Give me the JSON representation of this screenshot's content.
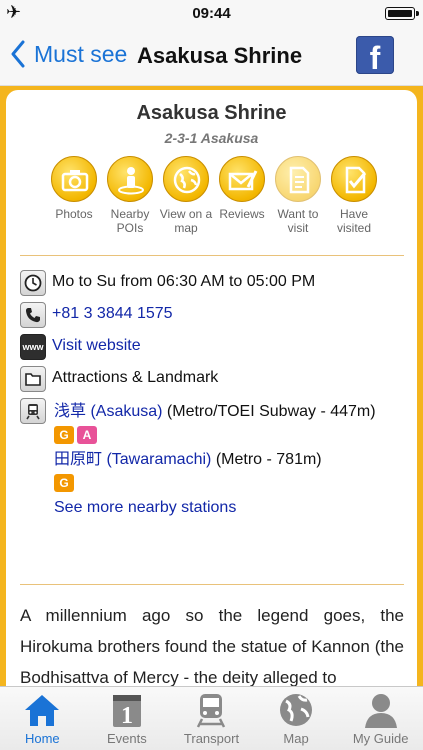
{
  "status": {
    "time": "09:44"
  },
  "nav": {
    "back_label": "Must see",
    "title": "Asakusa Shrine",
    "facebook_label": "f"
  },
  "place": {
    "name": "Asakusa Shrine",
    "address": "2-3-1 Asakusa"
  },
  "actions": [
    {
      "line1": "Photos",
      "line2": ""
    },
    {
      "line1": "Nearby",
      "line2": "POIs"
    },
    {
      "line1": "View on a",
      "line2": "map"
    },
    {
      "line1": "Reviews",
      "line2": ""
    },
    {
      "line1": "Want to",
      "line2": "visit"
    },
    {
      "line1": "Have",
      "line2": "visited"
    }
  ],
  "info": {
    "hours": "Mo to Su from 06:30 AM to 05:00 PM",
    "phone": "+81 3 3844 1575",
    "website": "Visit website",
    "www_icon": "www",
    "category": "Attractions & Landmark"
  },
  "stations": [
    {
      "name": "浅草 (Asakusa)",
      "detail": " (Metro/TOEI Subway - 447m)",
      "badges": [
        "G",
        "A"
      ]
    },
    {
      "name": "田原町 (Tawaramachi)",
      "detail": " (Metro - 781m)",
      "badges": [
        "G"
      ]
    }
  ],
  "badge_colors": {
    "G": "#f39700",
    "A": "#e85298"
  },
  "see_more": "See more nearby stations",
  "description": "A millennium ago so the legend goes, the Hirokuma brothers found the statue of Kannon (the Bodhisattva of Mercy - the deity alleged to",
  "tabs": [
    {
      "label": "Home",
      "icon": "home-icon"
    },
    {
      "label": "Events",
      "icon": "calendar-icon",
      "calendar_day": "1"
    },
    {
      "label": "Transport",
      "icon": "train-icon"
    },
    {
      "label": "Map",
      "icon": "globe-icon"
    },
    {
      "label": "My Guide",
      "icon": "person-icon"
    }
  ],
  "colors": {
    "accent": "#1a73d6",
    "frame": "#f4b51e",
    "link": "#1227a8"
  }
}
